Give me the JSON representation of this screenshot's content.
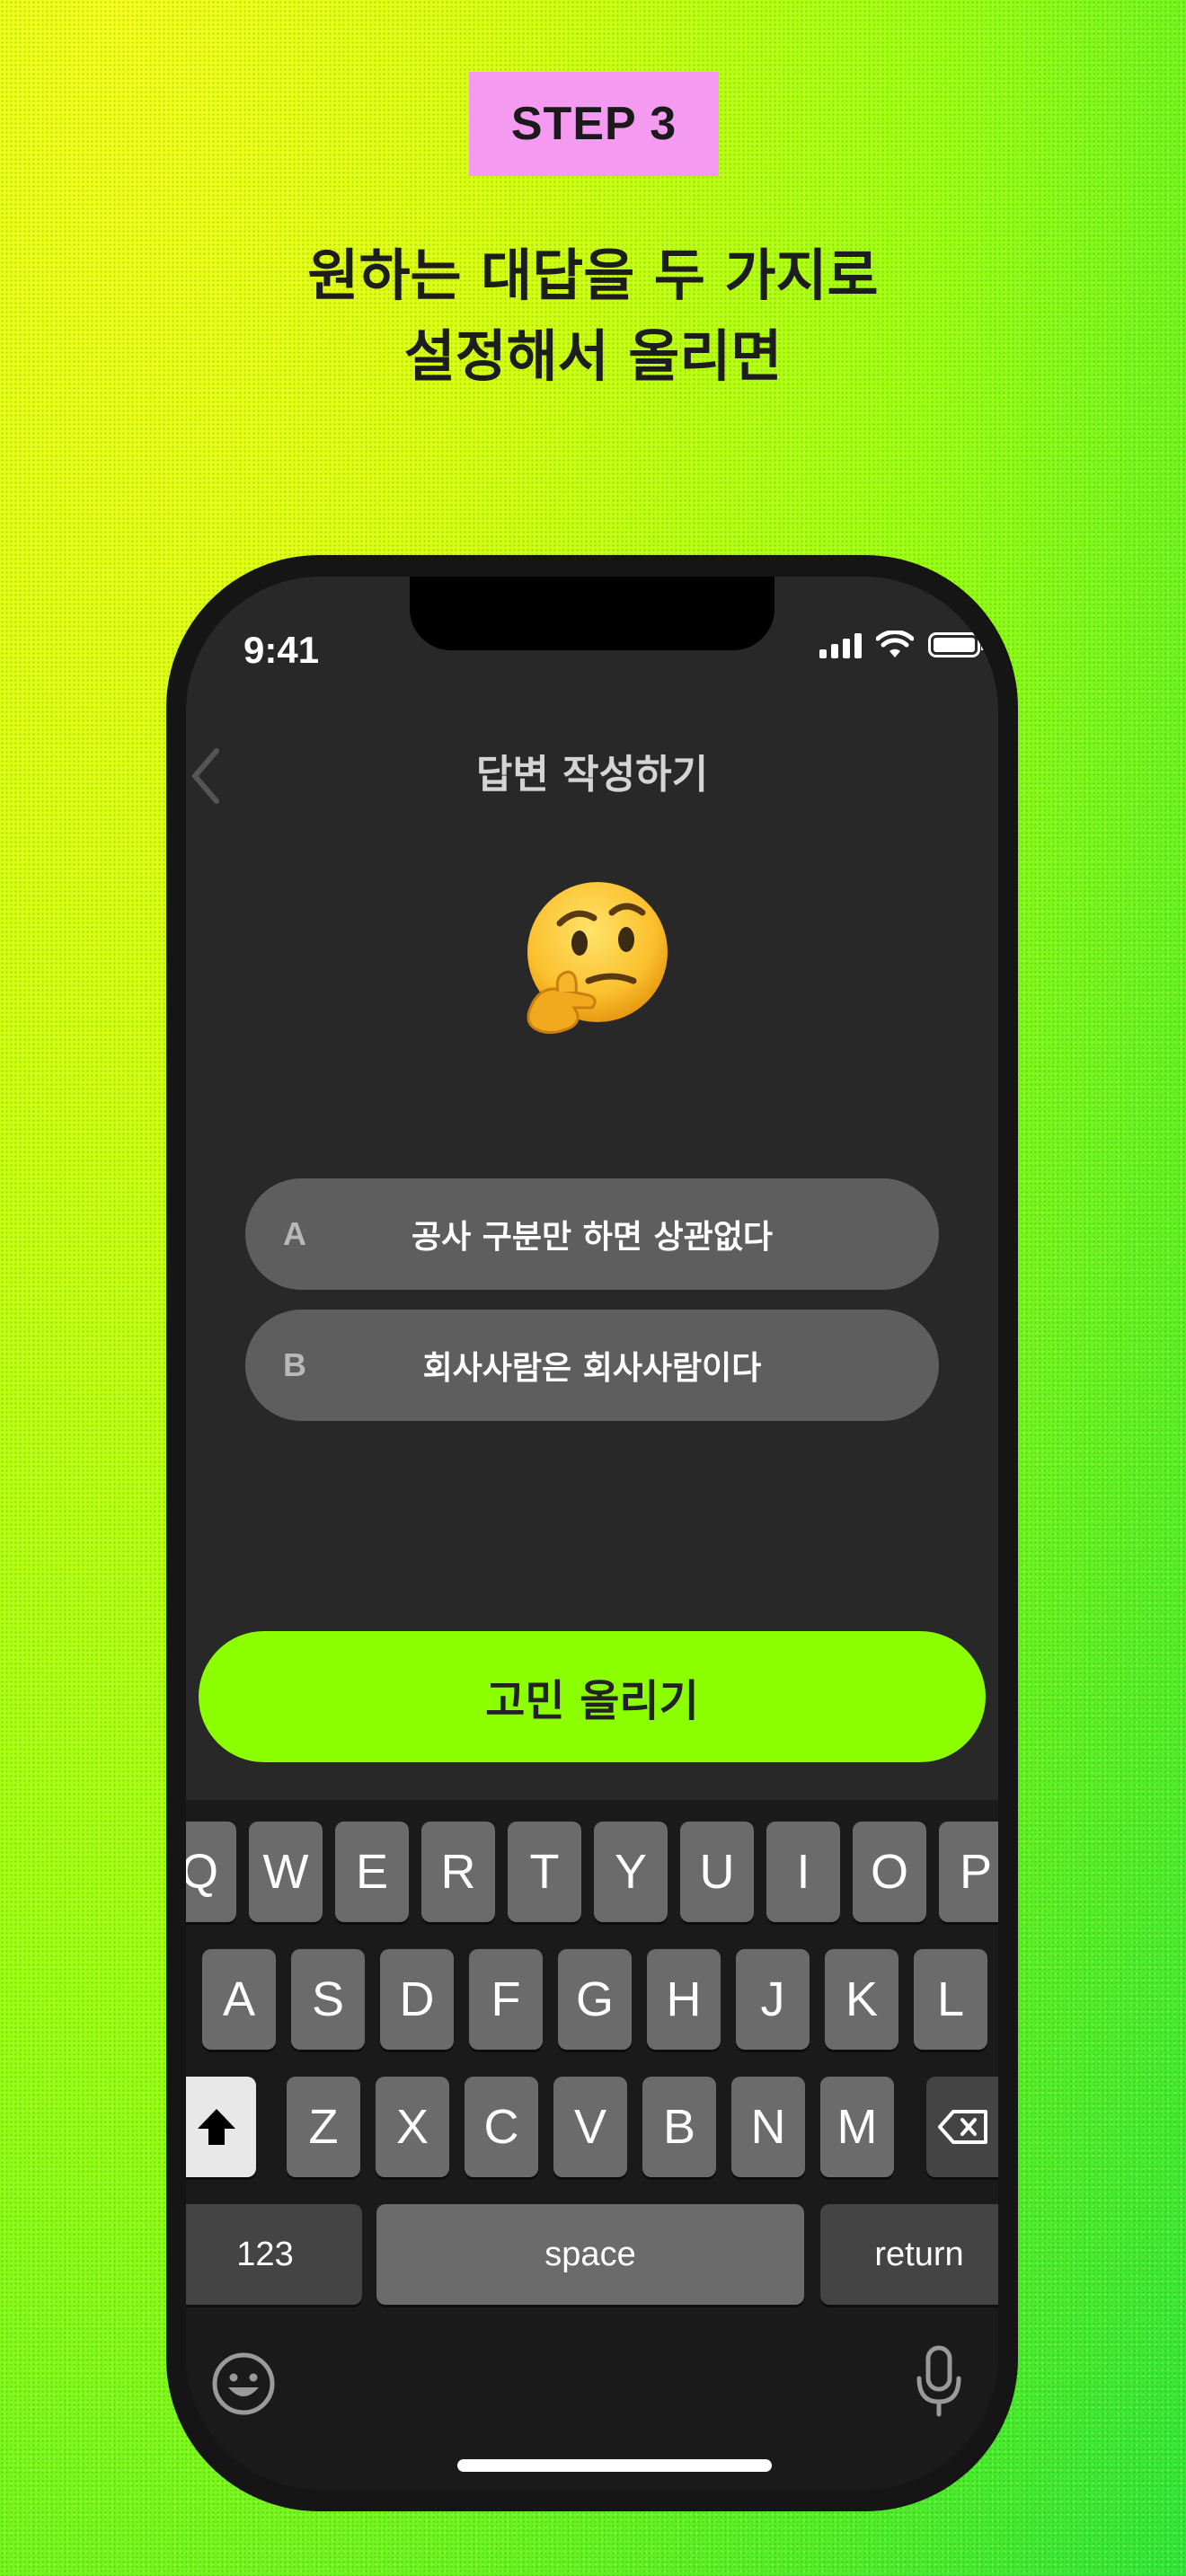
{
  "step_badge": "STEP 3",
  "headline": {
    "line1": "원하는 대답을 두 가지로",
    "line2": "설정해서 올리면"
  },
  "status_bar": {
    "time": "9:41"
  },
  "nav": {
    "title": "답변 작성하기"
  },
  "emoji_icon": "thinking-face",
  "answers": [
    {
      "letter": "A",
      "text": "공사 구분만 하면 상관없다"
    },
    {
      "letter": "B",
      "text": "회사사람은 회사사람이다"
    }
  ],
  "submit_label": "고민 올리기",
  "keyboard": {
    "row1": [
      "Q",
      "W",
      "E",
      "R",
      "T",
      "Y",
      "U",
      "I",
      "O",
      "P"
    ],
    "row2": [
      "A",
      "S",
      "D",
      "F",
      "G",
      "H",
      "J",
      "K",
      "L"
    ],
    "row3": [
      "Z",
      "X",
      "C",
      "V",
      "B",
      "N",
      "M"
    ],
    "numbers_label": "123",
    "space_label": "space",
    "return_label": "return"
  },
  "colors": {
    "accent": "#8cff00",
    "badge": "#f59af1",
    "screen_bg": "#282828",
    "answer_bg": "#5e5e5e"
  }
}
